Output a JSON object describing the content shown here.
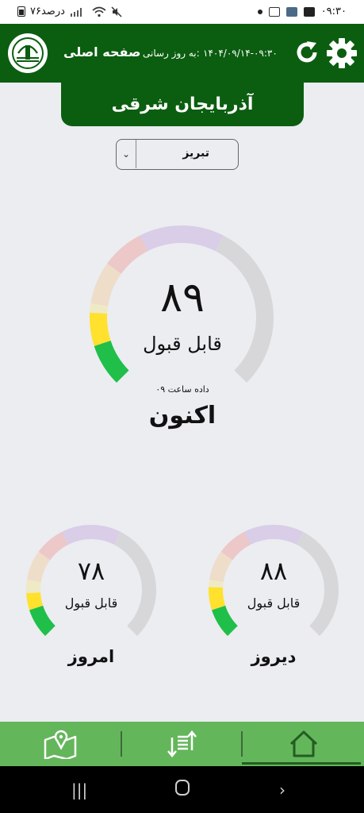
{
  "status_bar": {
    "battery": "۷۶درصد",
    "time": "۰۹:۳۰"
  },
  "header": {
    "title": "صفحه اصلی",
    "update_label": "به روز رسانی:",
    "update_time": "۱۴۰۴/۰۹/۱۴-۰۹:۳۰"
  },
  "region": "آذربایجان شرقی",
  "city_select": {
    "value": "تبریز"
  },
  "main_gauge": {
    "value": "۸۹",
    "status": "قابل قبول",
    "data_time": "داده ساعت ۰۹",
    "label": "اکنون",
    "level": 89
  },
  "small_gauges": [
    {
      "value": "۷۸",
      "status": "قابل قبول",
      "label": "امروز",
      "level": 78
    },
    {
      "value": "۸۸",
      "status": "قابل قبول",
      "label": "دیروز",
      "level": 88
    }
  ],
  "gauge_colors": {
    "good": "#1fbf4a",
    "moderate": "#ffe12e",
    "sensitive": "#f9a23c",
    "unhealthy": "#f3443a",
    "very_unhealthy": "#9b59c9",
    "hazardous": "#cfcfcf",
    "unfilled_track": "#d7d7d9"
  },
  "bottom_nav": {
    "items": [
      {
        "icon": "map-icon"
      },
      {
        "icon": "sort-icon"
      },
      {
        "icon": "home-icon",
        "active": true
      }
    ]
  }
}
